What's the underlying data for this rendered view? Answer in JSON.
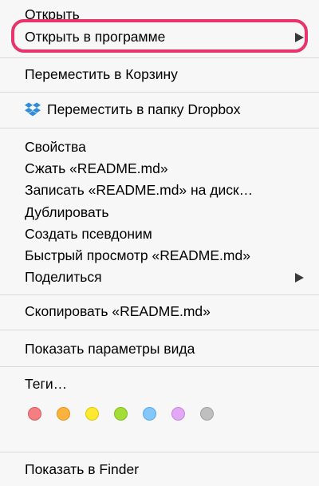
{
  "menu": {
    "items": {
      "open": {
        "label": "Открыть"
      },
      "open_with": {
        "label": "Открыть в программе"
      },
      "move_to_trash": {
        "label": "Переместить в Корзину"
      },
      "move_to_dropbox": {
        "label": "Переместить в папку Dropbox",
        "icon": "dropbox-icon"
      },
      "get_info": {
        "label": "Свойства"
      },
      "compress": {
        "label": "Сжать «README.md»"
      },
      "burn": {
        "label": "Записать «README.md» на диск…"
      },
      "duplicate": {
        "label": "Дублировать"
      },
      "make_alias": {
        "label": "Создать псевдоним"
      },
      "quick_look": {
        "label": "Быстрый просмотр «README.md»"
      },
      "share": {
        "label": "Поделиться"
      },
      "copy": {
        "label": "Скопировать «README.md»"
      },
      "view_options": {
        "label": "Показать параметры вида"
      },
      "tags": {
        "label": "Теги…"
      },
      "show_in_finder": {
        "label": "Показать в Finder"
      }
    },
    "tag_colors": [
      {
        "name": "red",
        "fill": "#f47e80",
        "stroke": "#d85b5e"
      },
      {
        "name": "orange",
        "fill": "#fdb23e",
        "stroke": "#e19420"
      },
      {
        "name": "yellow",
        "fill": "#fce930",
        "stroke": "#dcc70e"
      },
      {
        "name": "green",
        "fill": "#a3dd37",
        "stroke": "#83bd18"
      },
      {
        "name": "blue",
        "fill": "#84c7fa",
        "stroke": "#5aa8e3"
      },
      {
        "name": "purple",
        "fill": "#e2a8f5",
        "stroke": "#c585dd"
      },
      {
        "name": "gray",
        "fill": "#bfbfbf",
        "stroke": "#9f9f9f"
      }
    ],
    "highlight_color": "#e8346b"
  }
}
